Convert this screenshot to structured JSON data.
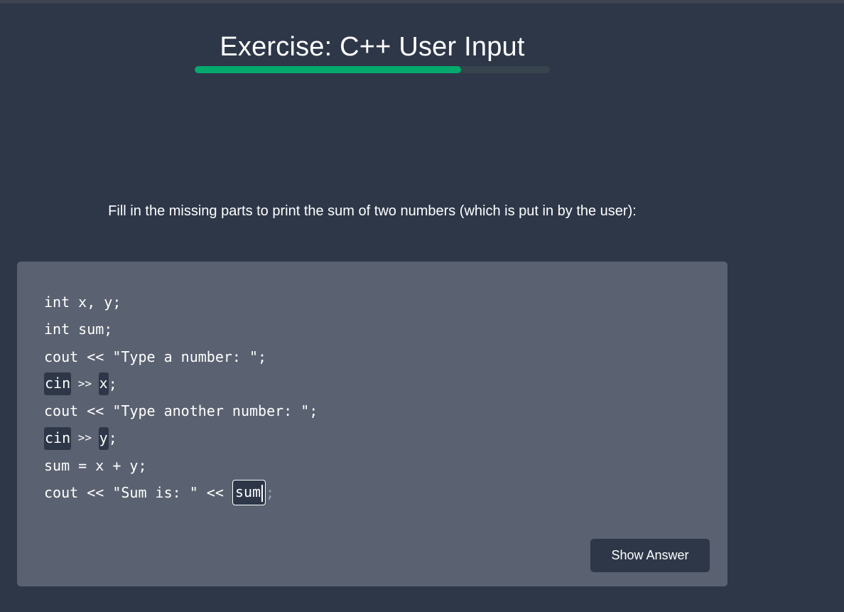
{
  "exercise": {
    "title": "Exercise: C++ User Input",
    "progress_percent": 75,
    "progress_color": "#04aa6d",
    "instructions": "Fill in the missing parts to print the sum of two numbers (which is put in by the user):"
  },
  "code": {
    "line1": "int x, y;",
    "line2": "int sum;",
    "line3": "cout << \"Type a number: \";",
    "line4": {
      "blank1": "cin",
      "op": " >> ",
      "blank2": "x",
      "end": ";"
    },
    "line5": "cout << \"Type another number: \";",
    "line6": {
      "blank1": "cin",
      "op": " >> ",
      "blank2": "y",
      "end": ";"
    },
    "line7": "sum = x + y;",
    "line8": {
      "prefix": "cout << \"Sum is: \" << ",
      "blank": "sum",
      "end": ";"
    }
  },
  "actions": {
    "show_answer_label": "Show Answer"
  }
}
